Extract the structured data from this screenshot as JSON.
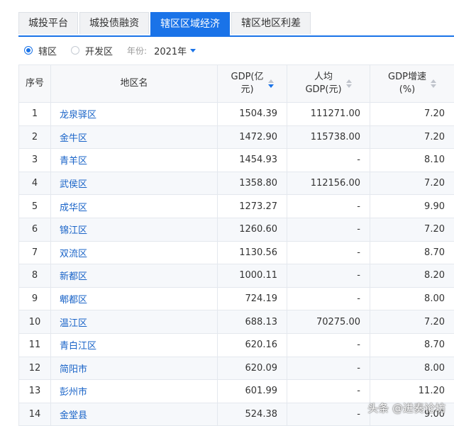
{
  "tabs": [
    {
      "label": "城投平台",
      "active": false
    },
    {
      "label": "城投债融资",
      "active": false
    },
    {
      "label": "辖区区域经济",
      "active": true
    },
    {
      "label": "辖区地区利差",
      "active": false
    }
  ],
  "filter": {
    "radio_district": "辖区",
    "radio_devzone": "开发区",
    "year_label": "年份:",
    "year_value": "2021年"
  },
  "table": {
    "headers": {
      "idx": "序号",
      "name": "地区名",
      "gdp_line1": "GDP(亿",
      "gdp_line2": "元)",
      "pcgdp_line1": "人均",
      "pcgdp_line2": "GDP(元)",
      "growth_line1": "GDP增速",
      "growth_line2": "(%)"
    },
    "rows": [
      {
        "idx": "1",
        "name": "龙泉驿区",
        "gdp": "1504.39",
        "pcgdp": "111271.00",
        "growth": "7.20"
      },
      {
        "idx": "2",
        "name": "金牛区",
        "gdp": "1472.90",
        "pcgdp": "115738.00",
        "growth": "7.20"
      },
      {
        "idx": "3",
        "name": "青羊区",
        "gdp": "1454.93",
        "pcgdp": "-",
        "growth": "8.10"
      },
      {
        "idx": "4",
        "name": "武侯区",
        "gdp": "1358.80",
        "pcgdp": "112156.00",
        "growth": "7.20"
      },
      {
        "idx": "5",
        "name": "成华区",
        "gdp": "1273.27",
        "pcgdp": "-",
        "growth": "9.90"
      },
      {
        "idx": "6",
        "name": "锦江区",
        "gdp": "1260.60",
        "pcgdp": "-",
        "growth": "7.20"
      },
      {
        "idx": "7",
        "name": "双流区",
        "gdp": "1130.56",
        "pcgdp": "-",
        "growth": "8.70"
      },
      {
        "idx": "8",
        "name": "新都区",
        "gdp": "1000.11",
        "pcgdp": "-",
        "growth": "8.20"
      },
      {
        "idx": "9",
        "name": "郫都区",
        "gdp": "724.19",
        "pcgdp": "-",
        "growth": "8.00"
      },
      {
        "idx": "10",
        "name": "温江区",
        "gdp": "688.13",
        "pcgdp": "70275.00",
        "growth": "7.20"
      },
      {
        "idx": "11",
        "name": "青白江区",
        "gdp": "620.16",
        "pcgdp": "-",
        "growth": "8.70"
      },
      {
        "idx": "12",
        "name": "简阳市",
        "gdp": "620.09",
        "pcgdp": "-",
        "growth": "8.00"
      },
      {
        "idx": "13",
        "name": "彭州市",
        "gdp": "601.99",
        "pcgdp": "-",
        "growth": "11.20"
      },
      {
        "idx": "14",
        "name": "金堂县",
        "gdp": "524.38",
        "pcgdp": "-",
        "growth": "9.00"
      }
    ]
  },
  "watermark": "头条 @进奏论坊"
}
